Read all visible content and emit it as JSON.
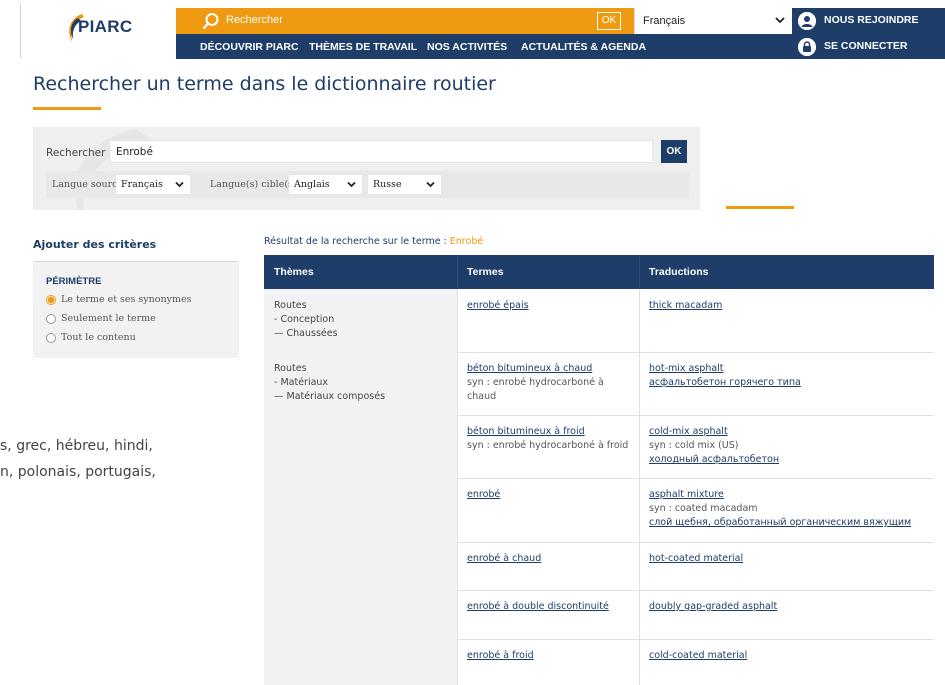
{
  "header": {
    "logo_text": "PIARC",
    "search_placeholder": "Rechercher",
    "search_ok": "OK",
    "language": "Français",
    "join": "NOUS REJOINDRE",
    "login": "SE CONNECTER",
    "nav": [
      "DÉCOUVRIR PIARC",
      "THÈMES DE TRAVAIL",
      "NOS ACTIVITÉS",
      "ACTUALITÉS & AGENDA"
    ]
  },
  "page": {
    "title": "Rechercher un terme dans le dictionnaire routier"
  },
  "search_panel": {
    "label": "Rechercher",
    "value": "Enrobé",
    "ok": "OK",
    "source_label": "Langue source",
    "source_value": "Français",
    "target_label": "Langue(s) cible(s)",
    "target_1": "Anglais",
    "target_2": "Russe"
  },
  "criteria": {
    "title": "Ajouter des critères",
    "section": "PÉRIMÈTRE",
    "options": [
      "Le terme et ses synonymes",
      "Seulement le terme",
      "Tout le contenu"
    ],
    "selected_index": 0
  },
  "background_text": {
    "line1": "s, grec, hébreu, hindi,",
    "line2": "n, polonais, portugais,"
  },
  "results": {
    "caption_prefix": "Résultat de la recherche sur le terme : ",
    "caption_term": "Enrobé",
    "columns": [
      "Thèmes",
      "Termes",
      "Traductions"
    ],
    "groups": [
      {
        "theme": [
          "Routes",
          "- Conception",
          "— Chaussées"
        ],
        "rows": [
          {
            "term": "enrobé épais",
            "term_syn": "",
            "translations": [
              "thick macadam"
            ],
            "tr_syn": "",
            "tr_ru": ""
          }
        ]
      },
      {
        "theme": [
          "Routes",
          "- Matériaux",
          "— Matériaux composés"
        ],
        "rows": [
          {
            "term": "béton bitumineux à chaud",
            "term_syn": "syn : enrobé hydrocarboné à chaud",
            "translations": [
              "hot-mix asphalt"
            ],
            "tr_syn": "",
            "tr_ru": "асфальтобетон горячего типа"
          },
          {
            "term": "béton bitumineux à froid",
            "term_syn": "syn : enrobé hydrocarboné à froid",
            "translations": [
              "cold-mix asphalt"
            ],
            "tr_syn": "syn : cold mix (US)",
            "tr_ru": "холодный асфальтобетон"
          },
          {
            "term": "enrobé",
            "term_syn": "",
            "translations": [
              "asphalt mixture"
            ],
            "tr_syn": "syn : coated macadam",
            "tr_ru": "слой щебня, обработанный органическим вяжущим"
          },
          {
            "term": "enrobé à chaud",
            "term_syn": "",
            "translations": [
              "hot-coated material"
            ],
            "tr_syn": "",
            "tr_ru": ""
          },
          {
            "term": "enrobé à double discontinuité",
            "term_syn": "",
            "translations": [
              "doubly gap-graded asphalt"
            ],
            "tr_syn": "",
            "tr_ru": ""
          },
          {
            "term": "enrobé à froid",
            "term_syn": "",
            "translations": [
              "cold-coated material"
            ],
            "tr_syn": "",
            "tr_ru": ""
          }
        ]
      }
    ]
  },
  "colors": {
    "brand_blue": "#1e3d68",
    "accent_orange": "#f09a12"
  }
}
